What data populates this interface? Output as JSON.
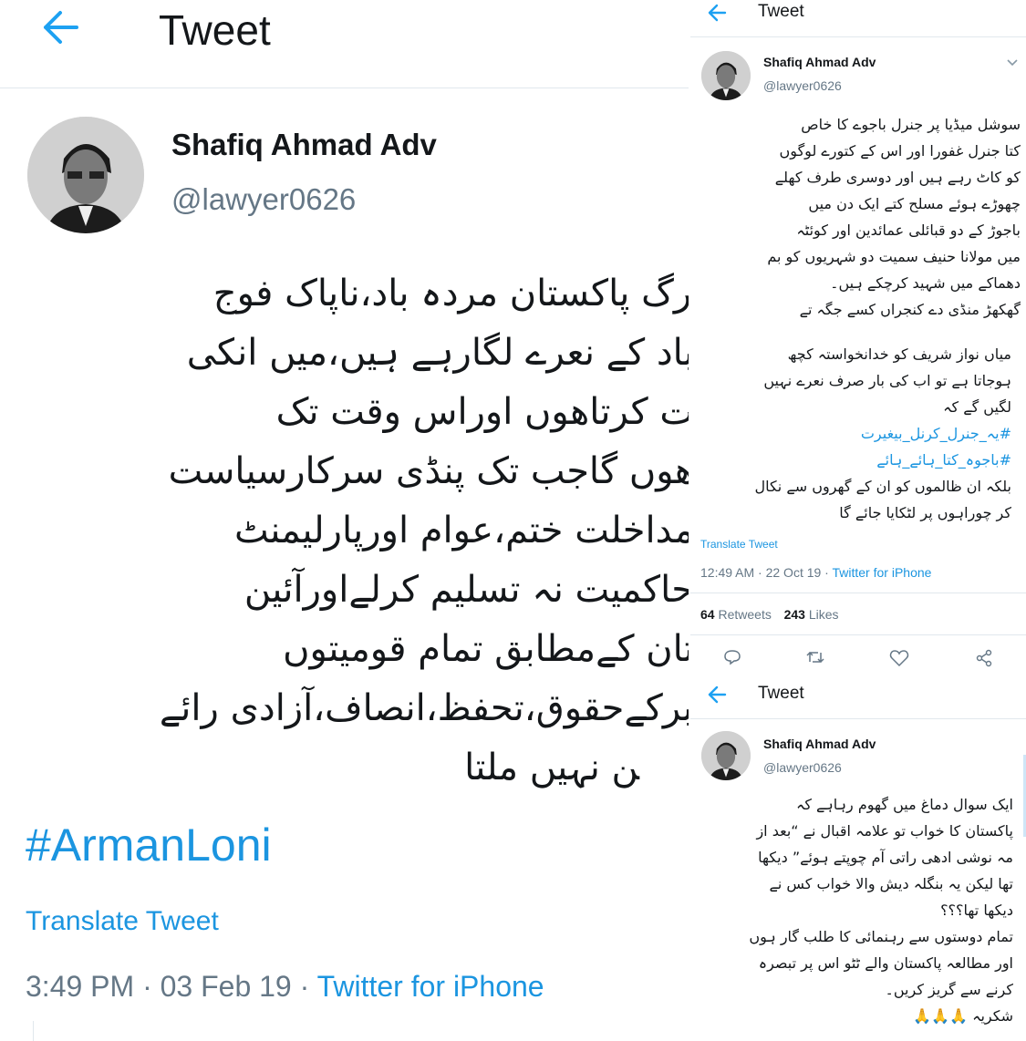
{
  "left": {
    "header_title": "Tweet",
    "author_name": "Shafiq Ahmad Adv",
    "author_handle": "@lawyer0626",
    "body_lines": [
      "ﺮگ پاکستان مردہ باد،ناپاک فوج",
      "باد کے نعرے لگارہے ہیں،میں انکی",
      "ت کرتاھوں اوراس وقت تک",
      "ھوں گاجب تک پنڈی سرکارسیاست",
      "مداخلت ختم،عوام اورپارلیمنٹ",
      "حاکمیت نہ تسلیم کرلےاورآئین",
      "تان کےمطابق تمام قومیتوں",
      "ﺒﺮکےحقوق،تحفظ،انصاف،آزادی رائے",
      "ﻦ نہیں ملتا"
    ],
    "hashtag": "#ArmanLoni",
    "translate_label": "Translate Tweet",
    "time": "3:49 PM · 03 Feb 19 · ",
    "source": "Twitter for iPhone"
  },
  "right_top": {
    "header_title": "Tweet",
    "author_name": "Shafiq Ahmad Adv",
    "author_handle": "@lawyer0626",
    "body_lines": [
      "سوشل میڈیا پر جنرل باجوے کا خاص",
      "کتا جنرل غفورا  اور اس کے کتورے لوگوں",
      "کو کاٹ رہے ہیں اور دوسری طرف کھلے",
      "چھوڑے ہوئے مسلح کتے ایک دن میں",
      "باجوڑ کے دو قبائلی عمائدین اور کوئٹہ",
      "میں مولانا حنیف سمیت دو شہریوں کو بم",
      "دھماکے میں شہید کرچکے ہیں۔",
      "گھکھڑ منڈی دے کنجراں کسے جگہ تے"
    ]
  },
  "right_middle": {
    "body_lines": [
      "میاں نواز شریف کو خدانخواستہ کچھ",
      "ہوجاتا ہے تو اب کی بار صرف نعرے نہیں",
      "لگیں گے کہ"
    ],
    "hashtags": [
      "#یہ_جنرل_کرنل_بیغیرت",
      "#باجوہ_کتا_ہائے_ہائے"
    ],
    "body_lines_2": [
      "بلکہ ان ظالموں کو ان کے گھروں سے نکال",
      "کر چوراہوں پر لٹکایا جائے گا"
    ],
    "translate_label": "Translate Tweet",
    "time": "12:49 AM · 22 Oct 19 · ",
    "source": "Twitter for iPhone",
    "retweets_count": "64",
    "retweets_label": "Retweets",
    "likes_count": "243",
    "likes_label": "Likes"
  },
  "right_bottom": {
    "header_title": "Tweet",
    "author_name": "Shafiq Ahmad Adv",
    "author_handle": "@lawyer0626",
    "body_lines": [
      "ایک سوال دماغ میں گھوم رہاہے کہ",
      "پاکستان کا خواب تو علامہ اقبال نے “بعد از",
      "مہ نوشی ادھی راتی آم چوپتے ہوئے” دیکھا",
      "تھا لیکن یہ بنگلہ دیش والا خواب کس نے",
      "دیکھا تھا؟؟؟",
      "تمام دوستوں سے رہنمائی کا طلب گار ہوں",
      "اور مطالعہ پاکستان والے ٹٹو اس پر تبصرہ",
      "کرنے سے گریز کریں۔",
      "شکریہ 🙏🙏🙏"
    ]
  }
}
